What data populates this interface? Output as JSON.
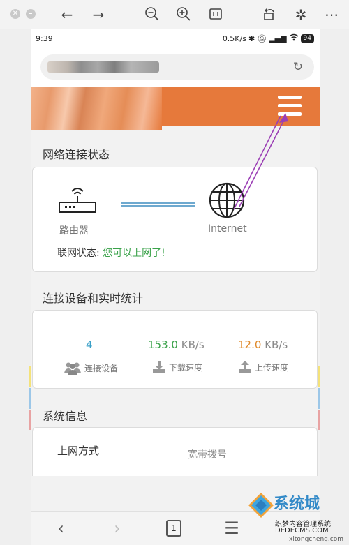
{
  "viewer_toolbar": {
    "icons": [
      "close-icon",
      "minimize-icon",
      "back-arrow-icon",
      "forward-arrow-icon",
      "zoom-out-icon",
      "zoom-in-icon",
      "fit-icon",
      "rotate-icon",
      "magic-wand-icon",
      "more-icon"
    ]
  },
  "status_bar": {
    "time": "9:39",
    "speed": "0.5K/s",
    "battery": "94"
  },
  "header": {
    "menu_icon": "hamburger-menu-icon",
    "accent_color": "#e6793b"
  },
  "network_status": {
    "section_title": "网络连接状态",
    "router_label": "路由器",
    "internet_label": "Internet",
    "status_label": "联网状态:",
    "status_value": "您可以上网了!"
  },
  "stats": {
    "section_title": "连接设备和实时统计",
    "devices_value": "4",
    "devices_label": "连接设备",
    "download_value": "153.0",
    "download_unit": "KB/s",
    "download_label": "下载速度",
    "upload_value": "12.0",
    "upload_unit": "KB/s",
    "upload_label": "上传速度",
    "colors": {
      "devices": "#3aa0c8",
      "download": "#3aa24a",
      "upload": "#e08a2b"
    }
  },
  "system_info": {
    "section_title": "系统信息",
    "rows": [
      {
        "label": "上网方式",
        "value": "宽带拨号"
      }
    ]
  },
  "bottom_nav": {
    "tab_count": "1"
  },
  "watermark": {
    "brand": "系统城",
    "line1": "织梦内容管理系统",
    "line2": "DEDECMS.COM",
    "line3": "xitongcheng.com"
  }
}
